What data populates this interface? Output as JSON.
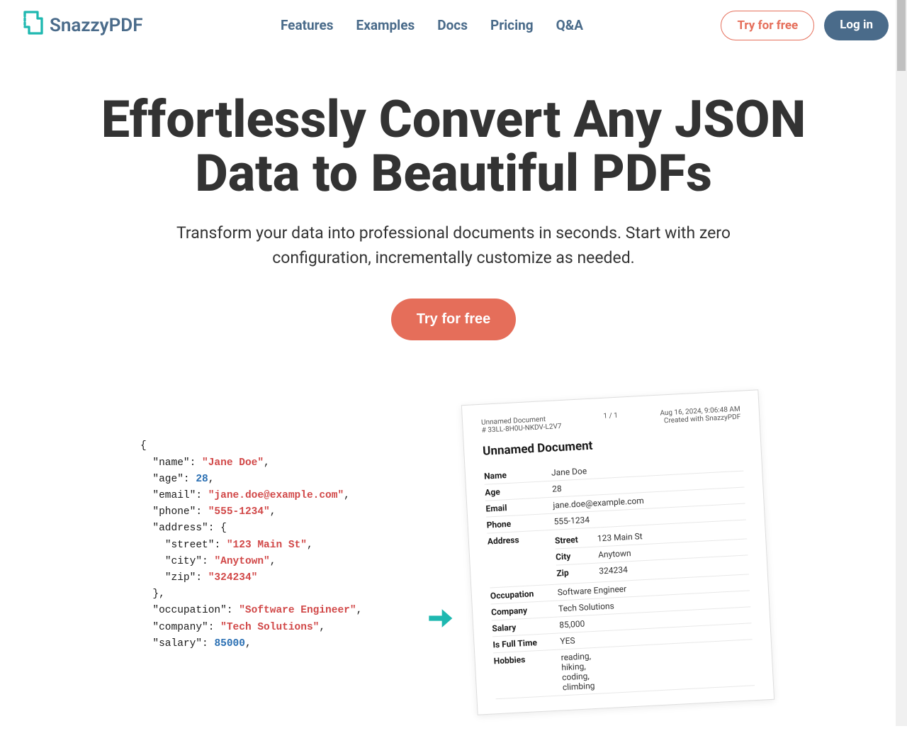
{
  "logo": {
    "name": "SnazzyPDF"
  },
  "nav": {
    "features": "Features",
    "examples": "Examples",
    "docs": "Docs",
    "pricing": "Pricing",
    "qa": "Q&A"
  },
  "header_actions": {
    "try_free": "Try for free",
    "login": "Log in"
  },
  "hero": {
    "title": "Effortlessly Convert Any JSON Data to Beautiful PDFs",
    "subtitle": "Transform your data into professional documents in seconds. Start with zero configuration, incrementally customize as needed.",
    "cta": "Try for free"
  },
  "code": {
    "name_key": "\"name\"",
    "name_val": "\"Jane Doe\"",
    "age_key": "\"age\"",
    "age_val": "28",
    "email_key": "\"email\"",
    "email_val": "\"jane.doe@example.com\"",
    "phone_key": "\"phone\"",
    "phone_val": "\"555-1234\"",
    "address_key": "\"address\"",
    "street_key": "\"street\"",
    "street_val": "\"123 Main St\"",
    "city_key": "\"city\"",
    "city_val": "\"Anytown\"",
    "zip_key": "\"zip\"",
    "zip_val": "\"324234\"",
    "occupation_key": "\"occupation\"",
    "occupation_val": "\"Software Engineer\"",
    "company_key": "\"company\"",
    "company_val": "\"Tech Solutions\"",
    "salary_key": "\"salary\"",
    "salary_val": "85000"
  },
  "pdf": {
    "header_doc": "Unnamed Document",
    "header_id": "# 33LL-8H0U-NKDV-L2V7",
    "header_page": "1 / 1",
    "header_date": "Aug 16, 2024, 9:06:48 AM",
    "header_created": "Created with SnazzyPDF",
    "title": "Unnamed Document",
    "rows": {
      "name_label": "Name",
      "name_value": "Jane Doe",
      "age_label": "Age",
      "age_value": "28",
      "email_label": "Email",
      "email_value": "jane.doe@example.com",
      "phone_label": "Phone",
      "phone_value": "555-1234",
      "address_label": "Address",
      "street_label": "Street",
      "street_value": "123 Main St",
      "city_label": "City",
      "city_value": "Anytown",
      "zip_label": "Zip",
      "zip_value": "324234",
      "occupation_label": "Occupation",
      "occupation_value": "Software Engineer",
      "company_label": "Company",
      "company_value": "Tech Solutions",
      "salary_label": "Salary",
      "salary_value": "85,000",
      "fulltime_label": "Is Full Time",
      "fulltime_value": "YES",
      "hobbies_label": "Hobbies",
      "hobbies_value": "reading,\nhiking,\ncoding,\nclimbing"
    }
  }
}
